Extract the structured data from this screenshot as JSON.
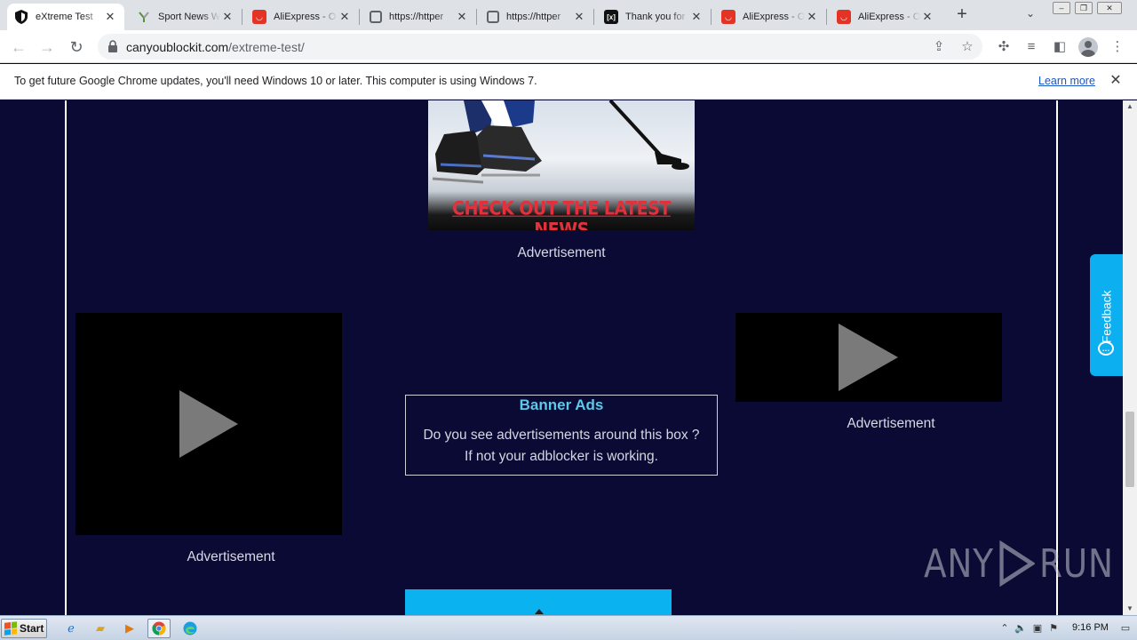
{
  "browser": {
    "tabs": [
      {
        "title": "eXtreme Test",
        "favicon": "shield-icon",
        "active": true
      },
      {
        "title": "Sport News W",
        "favicon": "sport-icon",
        "active": false
      },
      {
        "title": "AliExpress - O",
        "favicon": "aliexpress-icon",
        "active": false
      },
      {
        "title": "https://httper",
        "favicon": "globe-icon",
        "active": false
      },
      {
        "title": "https://httper",
        "favicon": "globe-icon",
        "active": false
      },
      {
        "title": "Thank you for",
        "favicon": "x-logo-icon",
        "active": false
      },
      {
        "title": "AliExpress - O",
        "favicon": "aliexpress-icon",
        "active": false
      },
      {
        "title": "AliExpress - O",
        "favicon": "aliexpress-icon",
        "active": false
      }
    ],
    "url": {
      "domain": "canyoublockit.com",
      "path": "/extreme-test/"
    },
    "infobar": {
      "message": "To get future Google Chrome updates, you'll need Windows 10 or later. This computer is using Windows 7.",
      "link": "Learn more"
    }
  },
  "page": {
    "hockey_ad": {
      "cta": "CHECK OUT THE LATEST NEWS"
    },
    "ad_labels": {
      "top": "Advertisement",
      "left": "Advertisement",
      "right": "Advertisement"
    },
    "banner": {
      "title": "Banner Ads",
      "line1": "Do you see advertisements around this box ?",
      "line2": "If not your adblocker is working."
    },
    "feedback": "Feedback",
    "watermark": {
      "left": "ANY",
      "right": "RUN"
    }
  },
  "taskbar": {
    "start": "Start",
    "clock": "9:16 PM"
  },
  "colors": {
    "page_bg": "#0a0a35",
    "cta_red": "#e0313d",
    "banner_title": "#5ec8e8",
    "feedback_bg": "#0cb0f0",
    "aliexpress_red": "#e43225"
  }
}
